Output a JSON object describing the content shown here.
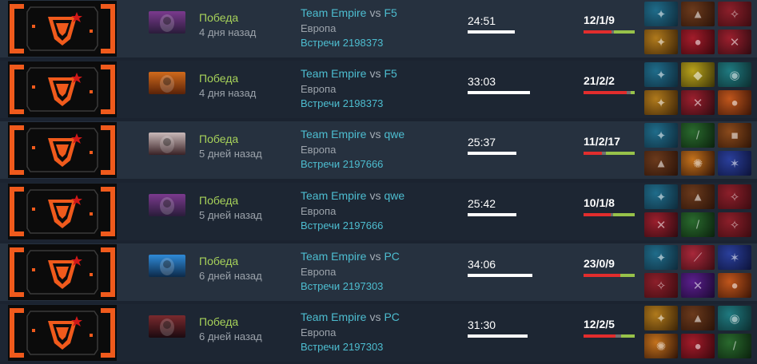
{
  "matches": [
    {
      "result": "Победа",
      "ago": "4 дня назад",
      "team": "Team Empire",
      "vs": "vs",
      "opponent": "F5",
      "region": "Европа",
      "series": "Встречи 2198373",
      "duration": "24:51",
      "duration_fraction": 0.64,
      "kda": "12/1/9",
      "kills": 12,
      "deaths": 1,
      "assists": 9,
      "hero_icon": "hero-portrait-purple-hooded",
      "hero_colors": [
        "#7b3a8e",
        "#2a1c3a"
      ],
      "items": [
        {
          "icon": "blue-claw-item-icon",
          "colors": [
            "#1f6c8a",
            "#0e2a3a"
          ],
          "glyph": "✦"
        },
        {
          "icon": "boots-item-icon",
          "colors": [
            "#6b3a1c",
            "#2a1208"
          ],
          "glyph": "▲"
        },
        {
          "icon": "red-blade-item-icon",
          "colors": [
            "#8c1f2a",
            "#3a0b10"
          ],
          "glyph": "✧"
        },
        {
          "icon": "gold-claw-item-icon",
          "colors": [
            "#b07a1c",
            "#3a2206"
          ],
          "glyph": "✦"
        },
        {
          "icon": "crimson-orb-item-icon",
          "colors": [
            "#a31c2a",
            "#38060c"
          ],
          "glyph": "●"
        },
        {
          "icon": "red-axe-item-icon",
          "colors": [
            "#9b1f2d",
            "#2e0a10"
          ],
          "glyph": "✕"
        }
      ]
    },
    {
      "result": "Победа",
      "ago": "4 дня назад",
      "team": "Team Empire",
      "vs": "vs",
      "opponent": "F5",
      "region": "Европа",
      "series": "Встречи 2198373",
      "duration": "33:03",
      "duration_fraction": 0.85,
      "kda": "21/2/2",
      "kills": 21,
      "deaths": 2,
      "assists": 2,
      "hero_icon": "hero-portrait-orange-haired",
      "hero_colors": [
        "#d06a1c",
        "#5a2208"
      ],
      "items": [
        {
          "icon": "blue-claw-item-icon",
          "colors": [
            "#1f6c8a",
            "#0e2a3a"
          ],
          "glyph": "✦"
        },
        {
          "icon": "gold-scale-item-icon",
          "colors": [
            "#b8a21c",
            "#3a3206"
          ],
          "glyph": "◆"
        },
        {
          "icon": "teal-lantern-item-icon",
          "colors": [
            "#1f7a80",
            "#0c2c2e"
          ],
          "glyph": "◉"
        },
        {
          "icon": "gold-claw-item-icon",
          "colors": [
            "#b07a1c",
            "#3a2206"
          ],
          "glyph": "✦"
        },
        {
          "icon": "red-axe-item-icon",
          "colors": [
            "#9b1f2d",
            "#2e0a10"
          ],
          "glyph": "✕"
        },
        {
          "icon": "crimson-orb-item-icon",
          "colors": [
            "#c0561c",
            "#3a1406"
          ],
          "glyph": "●"
        }
      ]
    },
    {
      "result": "Победа",
      "ago": "5 дней назад",
      "team": "Team Empire",
      "vs": "vs",
      "opponent": "qwe",
      "region": "Европа",
      "series": "Встречи 2197666",
      "duration": "25:37",
      "duration_fraction": 0.66,
      "kda": "11/2/17",
      "kills": 11,
      "deaths": 2,
      "assists": 17,
      "hero_icon": "hero-portrait-white-haired",
      "hero_colors": [
        "#c9b9b9",
        "#3a2226"
      ],
      "items": [
        {
          "icon": "blue-claw-item-icon",
          "colors": [
            "#1f6c8a",
            "#0e2a3a"
          ],
          "glyph": "✦"
        },
        {
          "icon": "green-staff-item-icon",
          "colors": [
            "#2a6a2e",
            "#0a200c"
          ],
          "glyph": "/"
        },
        {
          "icon": "treasure-chest-item-icon",
          "colors": [
            "#8a4a1c",
            "#2e1406"
          ],
          "glyph": "■"
        },
        {
          "icon": "boots-item-icon",
          "colors": [
            "#6b3a1c",
            "#2a1208"
          ],
          "glyph": "▲"
        },
        {
          "icon": "fire-staff-item-icon",
          "colors": [
            "#c4721c",
            "#2e1206"
          ],
          "glyph": "✺"
        },
        {
          "icon": "blue-sceptre-item-icon",
          "colors": [
            "#2a3f9b",
            "#0c1238"
          ],
          "glyph": "✶"
        }
      ]
    },
    {
      "result": "Победа",
      "ago": "5 дней назад",
      "team": "Team Empire",
      "vs": "vs",
      "opponent": "qwe",
      "region": "Европа",
      "series": "Встречи 2197666",
      "duration": "25:42",
      "duration_fraction": 0.66,
      "kda": "10/1/8",
      "kills": 10,
      "deaths": 1,
      "assists": 8,
      "hero_icon": "hero-portrait-purple-hooded",
      "hero_colors": [
        "#7b3a8e",
        "#2a1c3a"
      ],
      "items": [
        {
          "icon": "blue-claw-item-icon",
          "colors": [
            "#1f6c8a",
            "#0e2a3a"
          ],
          "glyph": "✦"
        },
        {
          "icon": "boots-item-icon",
          "colors": [
            "#6b3a1c",
            "#2a1208"
          ],
          "glyph": "▲"
        },
        {
          "icon": "red-blade-item-icon",
          "colors": [
            "#8c1f2a",
            "#3a0b10"
          ],
          "glyph": "✧"
        },
        {
          "icon": "red-axe-item-icon",
          "colors": [
            "#9b1f2d",
            "#2e0a10"
          ],
          "glyph": "✕"
        },
        {
          "icon": "green-staff-item-icon",
          "colors": [
            "#2a6a2e",
            "#0a200c"
          ],
          "glyph": "/"
        },
        {
          "icon": "red-blade-item-icon",
          "colors": [
            "#8c1f2a",
            "#3a0b10"
          ],
          "glyph": "✧"
        }
      ]
    },
    {
      "result": "Победа",
      "ago": "6 дней назад",
      "team": "Team Empire",
      "vs": "vs",
      "opponent": "PC",
      "region": "Европа",
      "series": "Встречи 2197303",
      "duration": "34:06",
      "duration_fraction": 0.88,
      "kda": "23/0/9",
      "kills": 23,
      "deaths": 0,
      "assists": 9,
      "hero_icon": "hero-portrait-blue-creature",
      "hero_colors": [
        "#2f8ad8",
        "#0c2a4a"
      ],
      "items": [
        {
          "icon": "blue-claw-item-icon",
          "colors": [
            "#1f6c8a",
            "#0e2a3a"
          ],
          "glyph": "✦"
        },
        {
          "icon": "red-dagger-item-icon",
          "colors": [
            "#a8283a",
            "#3a0c12"
          ],
          "glyph": "⟋"
        },
        {
          "icon": "blue-sceptre-item-icon",
          "colors": [
            "#2a3f9b",
            "#0c1238"
          ],
          "glyph": "✶"
        },
        {
          "icon": "red-blade-item-icon",
          "colors": [
            "#8c1f2a",
            "#3a0b10"
          ],
          "glyph": "✧"
        },
        {
          "icon": "purple-dagger-item-icon",
          "colors": [
            "#5a1f8c",
            "#1a0830"
          ],
          "glyph": "✕"
        },
        {
          "icon": "crimson-orb-item-icon",
          "colors": [
            "#c0561c",
            "#3a1406"
          ],
          "glyph": "●"
        }
      ]
    },
    {
      "result": "Победа",
      "ago": "6 дней назад",
      "team": "Team Empire",
      "vs": "vs",
      "opponent": "PC",
      "region": "Европа",
      "series": "Встречи 2197303",
      "duration": "31:30",
      "duration_fraction": 0.81,
      "kda": "12/2/5",
      "kills": 12,
      "deaths": 2,
      "assists": 5,
      "hero_icon": "hero-portrait-dark-armored",
      "hero_colors": [
        "#7a2a2e",
        "#1c0a10"
      ],
      "items": [
        {
          "icon": "gold-claw-item-icon",
          "colors": [
            "#b07a1c",
            "#3a2206"
          ],
          "glyph": "✦"
        },
        {
          "icon": "boots-item-icon",
          "colors": [
            "#6b3a1c",
            "#2a1208"
          ],
          "glyph": "▲"
        },
        {
          "icon": "teal-lantern-item-icon",
          "colors": [
            "#1f7a80",
            "#0c2c2e"
          ],
          "glyph": "◉"
        },
        {
          "icon": "fire-staff-item-icon",
          "colors": [
            "#c4721c",
            "#2e1206"
          ],
          "glyph": "✺"
        },
        {
          "icon": "crimson-orb-item-icon",
          "colors": [
            "#a31c2a",
            "#38060c"
          ],
          "glyph": "●"
        },
        {
          "icon": "green-staff-item-icon",
          "colors": [
            "#2a6a2e",
            "#0a200c"
          ],
          "glyph": "/"
        }
      ]
    }
  ],
  "theme": {
    "win_color": "#a7d25a",
    "link_color": "#4dbdd0",
    "kills_color": "#e22d2d",
    "deaths_color": "#707070",
    "assists_color": "#97c24a",
    "logo_accent": "#f05a1c"
  }
}
